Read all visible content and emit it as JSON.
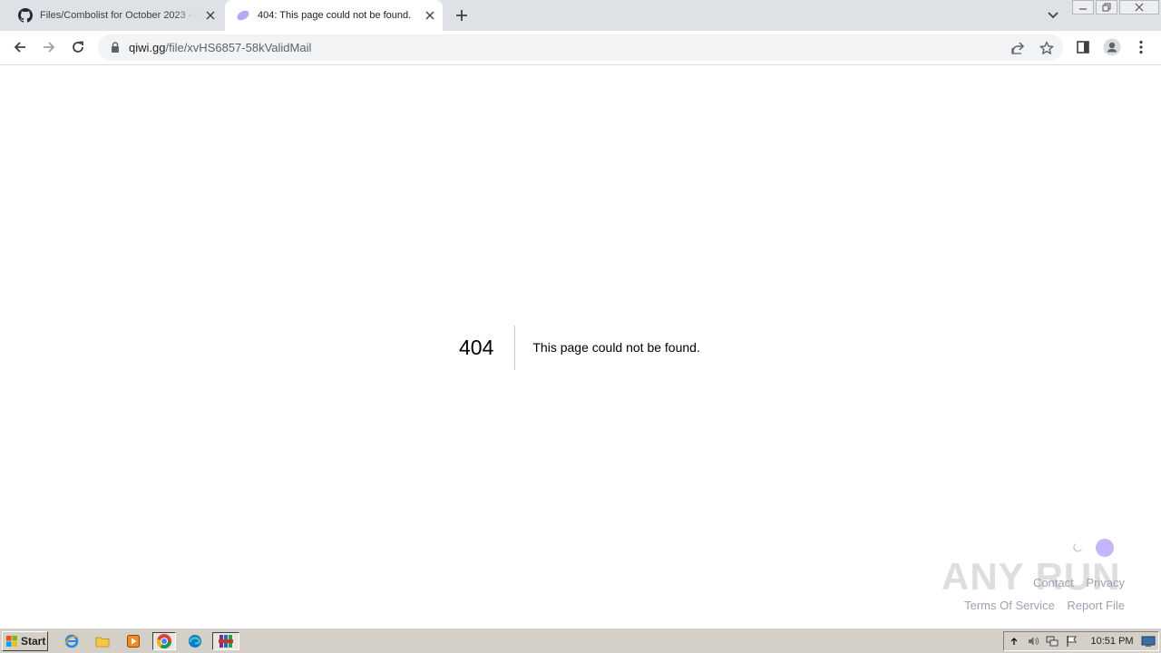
{
  "browser": {
    "tabs": [
      {
        "title": "Files/Combolist for October 2023 - Fr",
        "icon": "github-icon",
        "active": false
      },
      {
        "title": "404: This page could not be found.",
        "icon": "qiwi-favicon-icon",
        "active": true
      }
    ],
    "url_host": "qiwi.gg",
    "url_path": "/file/xvHS6857-58kValidMail"
  },
  "page": {
    "error_code": "404",
    "error_message": "This page could not be found.",
    "footer_links_row1": [
      "Contact",
      "Privacy"
    ],
    "footer_links_row2": [
      "Terms Of Service",
      "Report File"
    ],
    "watermark": "ANY RUN"
  },
  "taskbar": {
    "start_label": "Start",
    "clock": "10:51 PM"
  },
  "colors": {
    "tab_strip": "#dee1e6",
    "toggle_knob": "#c4b5fd",
    "taskbar": "#d4d0c8"
  }
}
